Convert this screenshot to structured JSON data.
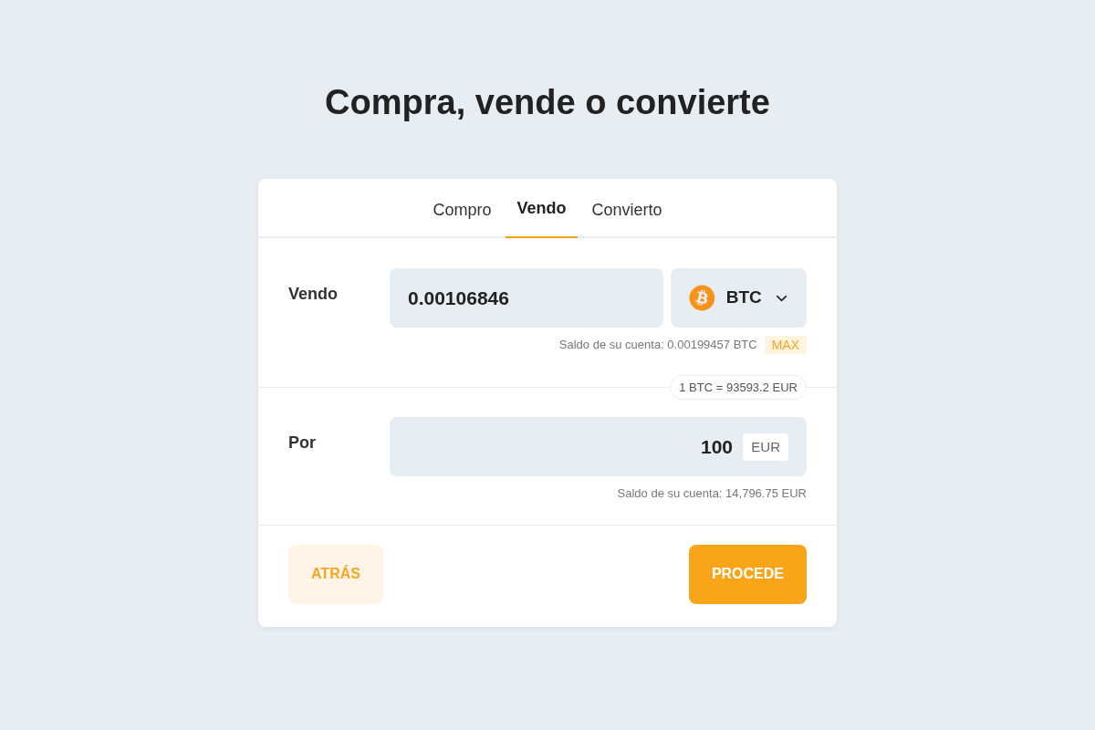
{
  "page": {
    "title": "Compra, vende o convierte"
  },
  "tabs": [
    {
      "label": "Compro",
      "selected": false
    },
    {
      "label": "Vendo",
      "selected": true
    },
    {
      "label": "Convierto",
      "selected": false
    }
  ],
  "sell": {
    "label": "Vendo",
    "amount": "0.00106846",
    "currency": "BTC",
    "balance": "Saldo de su cuenta: 0.00199457 BTC",
    "max_button": "MAX"
  },
  "rate": "1 BTC = 93593.2 EUR",
  "receive": {
    "label": "Por",
    "amount": "100",
    "currency": "EUR",
    "balance": "Saldo de su cuenta: 14,796.75 EUR"
  },
  "buttons": [
    {
      "label": "ATRÁS",
      "kind": "secondary"
    },
    {
      "label": "PROCEDE",
      "kind": "primary"
    }
  ]
}
